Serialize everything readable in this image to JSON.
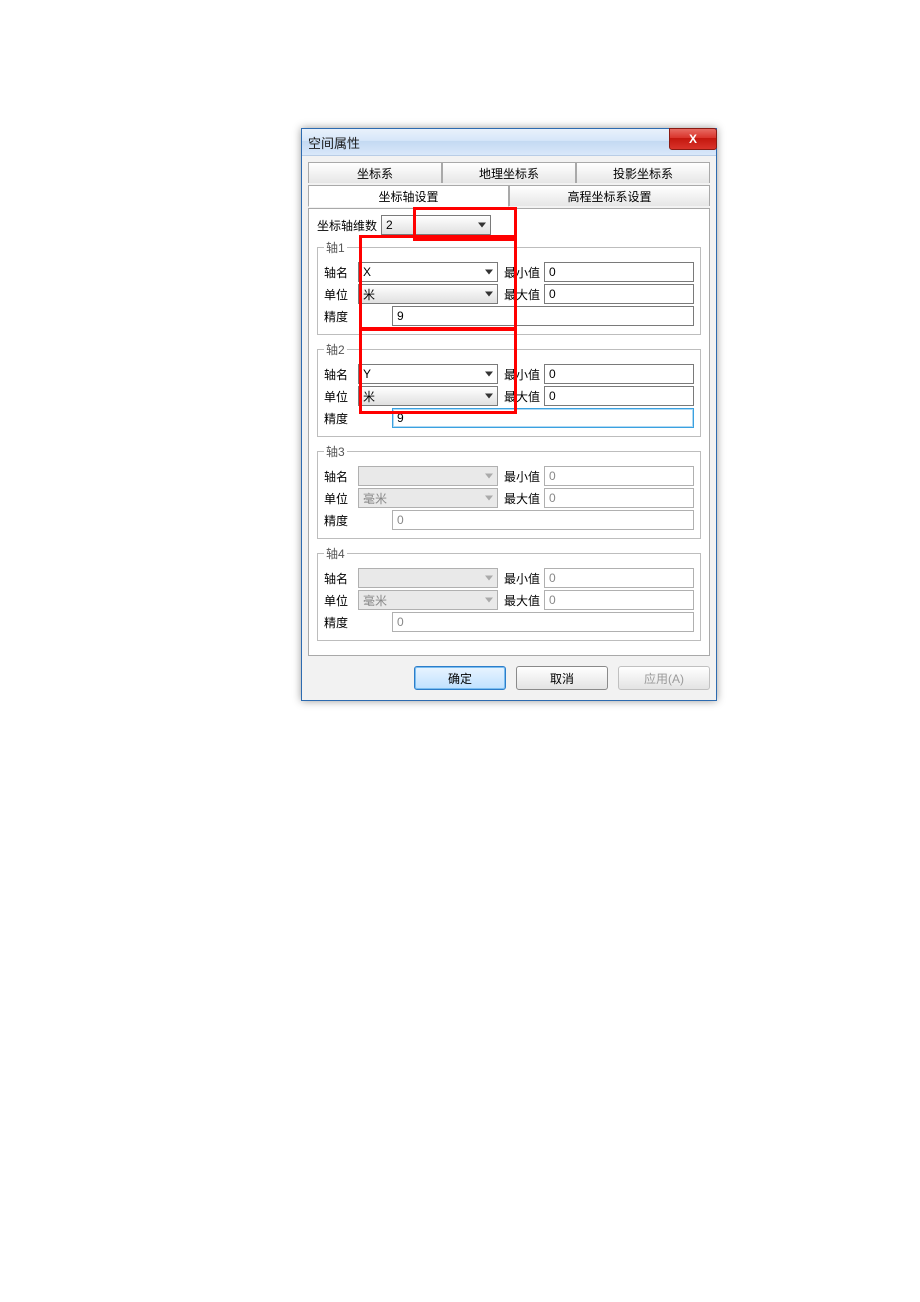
{
  "window": {
    "title": "空间属性",
    "close": "X"
  },
  "tabsTop": {
    "coordSys": "坐标系",
    "geoCoordSys": "地理坐标系",
    "projCoordSys": "投影坐标系"
  },
  "tabsSecond": {
    "axisSettings": "坐标轴设置",
    "elevationSettings": "高程坐标系设置"
  },
  "dimLabel": "坐标轴维数",
  "dimValue": "2",
  "labels": {
    "axisName": "轴名",
    "unit": "单位",
    "precision": "精度",
    "min": "最小值",
    "max": "最大值"
  },
  "axes": [
    {
      "legend": "轴1",
      "name": "X",
      "unit": "米",
      "precision": "9",
      "min": "0",
      "max": "0",
      "enabled": true
    },
    {
      "legend": "轴2",
      "name": "Y",
      "unit": "米",
      "precision": "9",
      "min": "0",
      "max": "0",
      "enabled": true
    },
    {
      "legend": "轴3",
      "name": "",
      "unit": "毫米",
      "precision": "0",
      "min": "0",
      "max": "0",
      "enabled": false
    },
    {
      "legend": "轴4",
      "name": "",
      "unit": "毫米",
      "precision": "0",
      "min": "0",
      "max": "0",
      "enabled": false
    }
  ],
  "buttons": {
    "ok": "确定",
    "cancel": "取消",
    "apply": "应用(A)"
  }
}
